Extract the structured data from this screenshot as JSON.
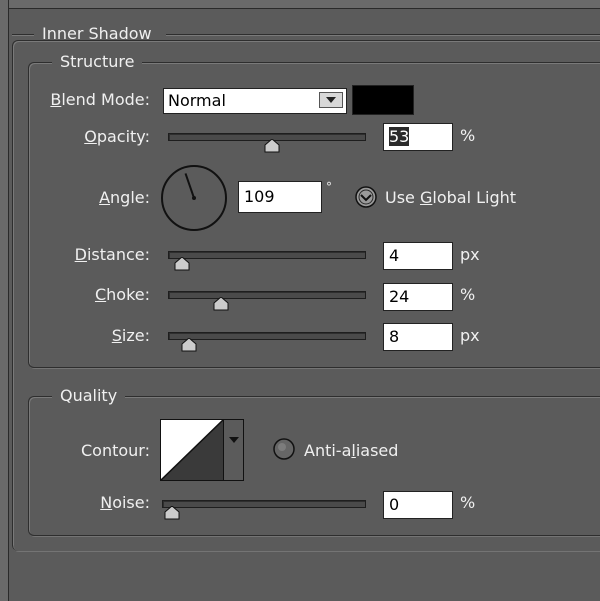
{
  "inner_shadow": {
    "title": "Inner Shadow"
  },
  "structure": {
    "title": "Structure",
    "blend_mode": {
      "label": "Blend Mode:",
      "value": "Normal",
      "color": "#000000"
    },
    "opacity": {
      "label": "Opacity:",
      "value": "53",
      "unit": "%",
      "level": 0.53
    },
    "angle": {
      "label": "Angle:",
      "value": "109",
      "unit": "°",
      "degrees": 109
    },
    "use_global_light": {
      "label": "Use Global Light",
      "checked": true
    },
    "distance": {
      "label": "Distance:",
      "value": "4",
      "unit": "px",
      "level": 0.02
    },
    "choke": {
      "label": "Choke:",
      "value": "24",
      "unit": "%",
      "level": 0.24
    },
    "size": {
      "label": "Size:",
      "value": "8",
      "unit": "px",
      "level": 0.06
    }
  },
  "quality": {
    "title": "Quality",
    "contour": {
      "label": "Contour:"
    },
    "anti_aliased": {
      "label": "Anti-aliased",
      "checked": false
    },
    "noise": {
      "label": "Noise:",
      "value": "0",
      "unit": "%",
      "level": 0.0
    }
  },
  "colors": {
    "panel": "#5b5b5b",
    "text": "#f0f0f0",
    "field_bg": "#ffffff"
  }
}
